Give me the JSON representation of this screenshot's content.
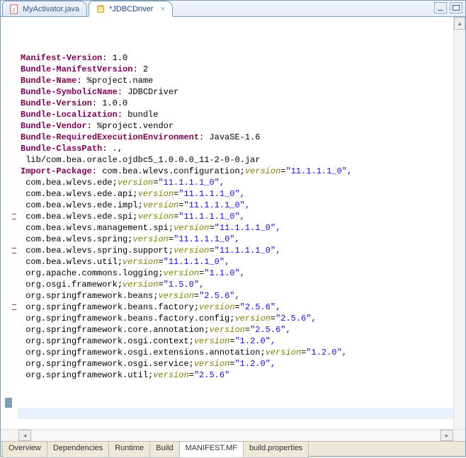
{
  "topTabs": {
    "inactive": {
      "label": "MyActivator.java"
    },
    "active": {
      "label": "*JDBCDriver"
    }
  },
  "manifest": {
    "k_mv": "Manifest-Version",
    "v_mv": "1.0",
    "k_bmv": "Bundle-ManifestVersion",
    "v_bmv": "2",
    "k_bn": "Bundle-Name",
    "v_bn": "%project.name",
    "k_bsn": "Bundle-SymbolicName",
    "v_bsn": "JDBCDriver",
    "k_bv": "Bundle-Version",
    "v_bv": "1.0.0",
    "k_bl": "Bundle-Localization",
    "v_bl": "bundle",
    "k_bve": "Bundle-Vendor",
    "v_bve": "%project.vendor",
    "k_bree": "Bundle-RequiredExecutionEnvironment",
    "v_bree": "JavaSE-1.6",
    "k_bcp": "Bundle-ClassPath",
    "v_bcp": ".,",
    "bcp_line2": " lib/com.bea.oracle.ojdbc5_1.0.0.0_11-2-0-0.jar",
    "k_ip": "Import-Package",
    "ip_head": "com.bea.wlevs.configuration;",
    "ip_ver": "\"11.1.1.1_0\",",
    "versionKey": "version",
    "pkg": [
      {
        "p": " com.bea.wlevs.ede;",
        "v": "\"11.1.1.1_0\","
      },
      {
        "p": " com.bea.wlevs.ede.api;",
        "v": "\"11.1.1.1_0\","
      },
      {
        "p": " com.bea.wlevs.ede.impl;",
        "v": "\"11.1.1.1_0\","
      },
      {
        "p": " com.bea.wlevs.ede.spi;",
        "v": "\"11.1.1.1_0\","
      },
      {
        "p": " com.bea.wlevs.management.spi;",
        "v": "\"11.1.1.1_0\","
      },
      {
        "p": " com.bea.wlevs.spring;",
        "v": "\"11.1.1.1_0\","
      },
      {
        "p": " com.bea.wlevs.spring.support;",
        "v": "\"11.1.1.1_0\","
      },
      {
        "p": " com.bea.wlevs.util;",
        "v": "\"11.1.1.1_0\","
      },
      {
        "p": " org.apache.commons.logging;",
        "v": "\"1.1.0\","
      },
      {
        "p": " org.osgi.framework;",
        "v": "\"1.5.0\","
      },
      {
        "p": " org.springframework.beans;",
        "v": "\"2.5.6\","
      },
      {
        "p": " org.springframework.beans.factory;",
        "v": "\"2.5.6\","
      },
      {
        "p": " org.springframework.beans.factory.config;",
        "v": "\"2.5.6\","
      },
      {
        "p": " org.springframework.core.annotation;",
        "v": "\"2.5.6\","
      },
      {
        "p": " org.springframework.osgi.context;",
        "v": "\"1.2.0\","
      },
      {
        "p": " org.springframework.osgi.extensions.annotation;",
        "v": "\"1.2.0\","
      },
      {
        "p": " org.springframework.osgi.service;",
        "v": "\"1.2.0\","
      },
      {
        "p": " org.springframework.util;",
        "v": "\"2.5.6\""
      }
    ]
  },
  "eq": "=",
  "colonSp": ": ",
  "bottomTabs": [
    "Overview",
    "Dependencies",
    "Runtime",
    "Build",
    "MANIFEST.MF",
    "build.properties"
  ],
  "activeBottom": "MANIFEST.MF"
}
